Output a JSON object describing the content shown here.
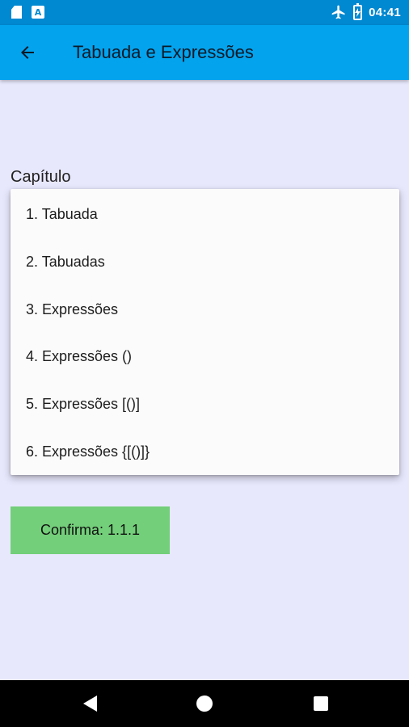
{
  "status_bar": {
    "time": "04:41",
    "left_icons": [
      "sd-card-icon",
      "a-notification-icon"
    ],
    "a_icon_letter": "A",
    "right_icons": [
      "airplane-mode-icon",
      "battery-charging-icon"
    ]
  },
  "app_bar": {
    "title": "Tabuada e Expressões",
    "back_icon": "arrow-left-icon",
    "color": "#03a3ee"
  },
  "form": {
    "field_label": "Capítulo",
    "dropdown_items": [
      "1. Tabuada",
      "2. Tabuadas",
      "3. Expressões",
      "4. Expressões ()",
      "5. Expressões [()]",
      "6. Expressões {[()]}"
    ],
    "confirm_label": "Confirma: 1.1.1",
    "confirm_color": "#73cf7a"
  },
  "nav_bar": {
    "buttons": [
      "back-triangle-icon",
      "home-circle-icon",
      "recents-square-icon"
    ]
  }
}
